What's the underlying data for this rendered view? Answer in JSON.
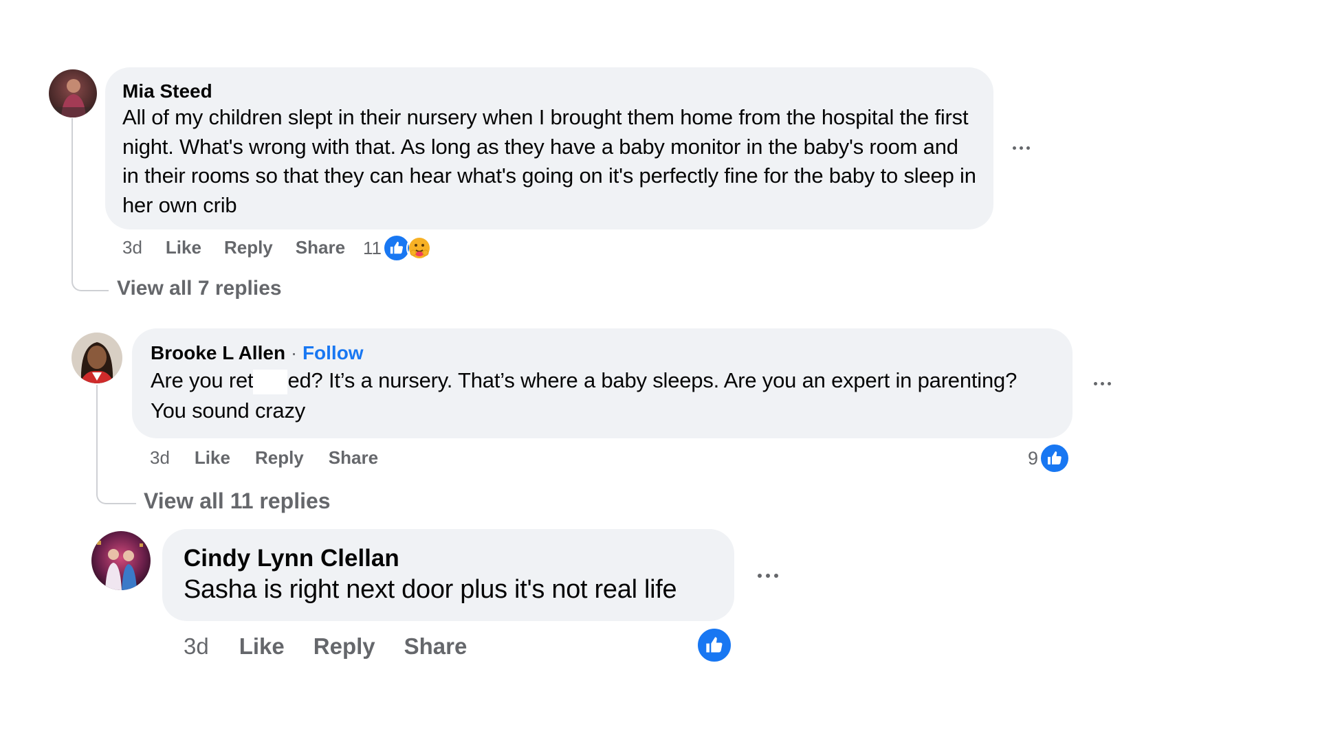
{
  "comments": [
    {
      "author": "Mia Steed",
      "text": "All of my children slept in their nursery when I brought them home from the hospital the first night. What's wrong with that. As long as they have a baby monitor in the baby's room and in their rooms so that they can hear what's going on it's perfectly fine for the baby to sleep in her own crib",
      "time": "3d",
      "like_label": "Like",
      "reply_label": "Reply",
      "share_label": "Share",
      "reaction_count": "11",
      "reactions": [
        "like-icon",
        "care-icon"
      ],
      "view_replies": "View all 7 replies"
    },
    {
      "author": "Brooke L Allen",
      "separator": " · ",
      "follow_label": "Follow",
      "text_before": "Are you ret",
      "text_after": "ed? It’s a nursery. That’s where a baby sleeps. Are you an expert in parenting? You sound crazy",
      "time": "3d",
      "like_label": "Like",
      "reply_label": "Reply",
      "share_label": "Share",
      "reaction_count": "9",
      "reactions": [
        "like-icon"
      ],
      "view_replies": "View all 11 replies"
    },
    {
      "author": "Cindy Lynn Clellan",
      "text": "Sasha is right next door plus it's not real life",
      "time": "3d",
      "like_label": "Like",
      "reply_label": "Reply",
      "share_label": "Share",
      "reactions": [
        "like-icon"
      ]
    }
  ],
  "colors": {
    "bubble": "#f0f2f5",
    "secondary_text": "#65676b",
    "accent": "#1877f2"
  }
}
